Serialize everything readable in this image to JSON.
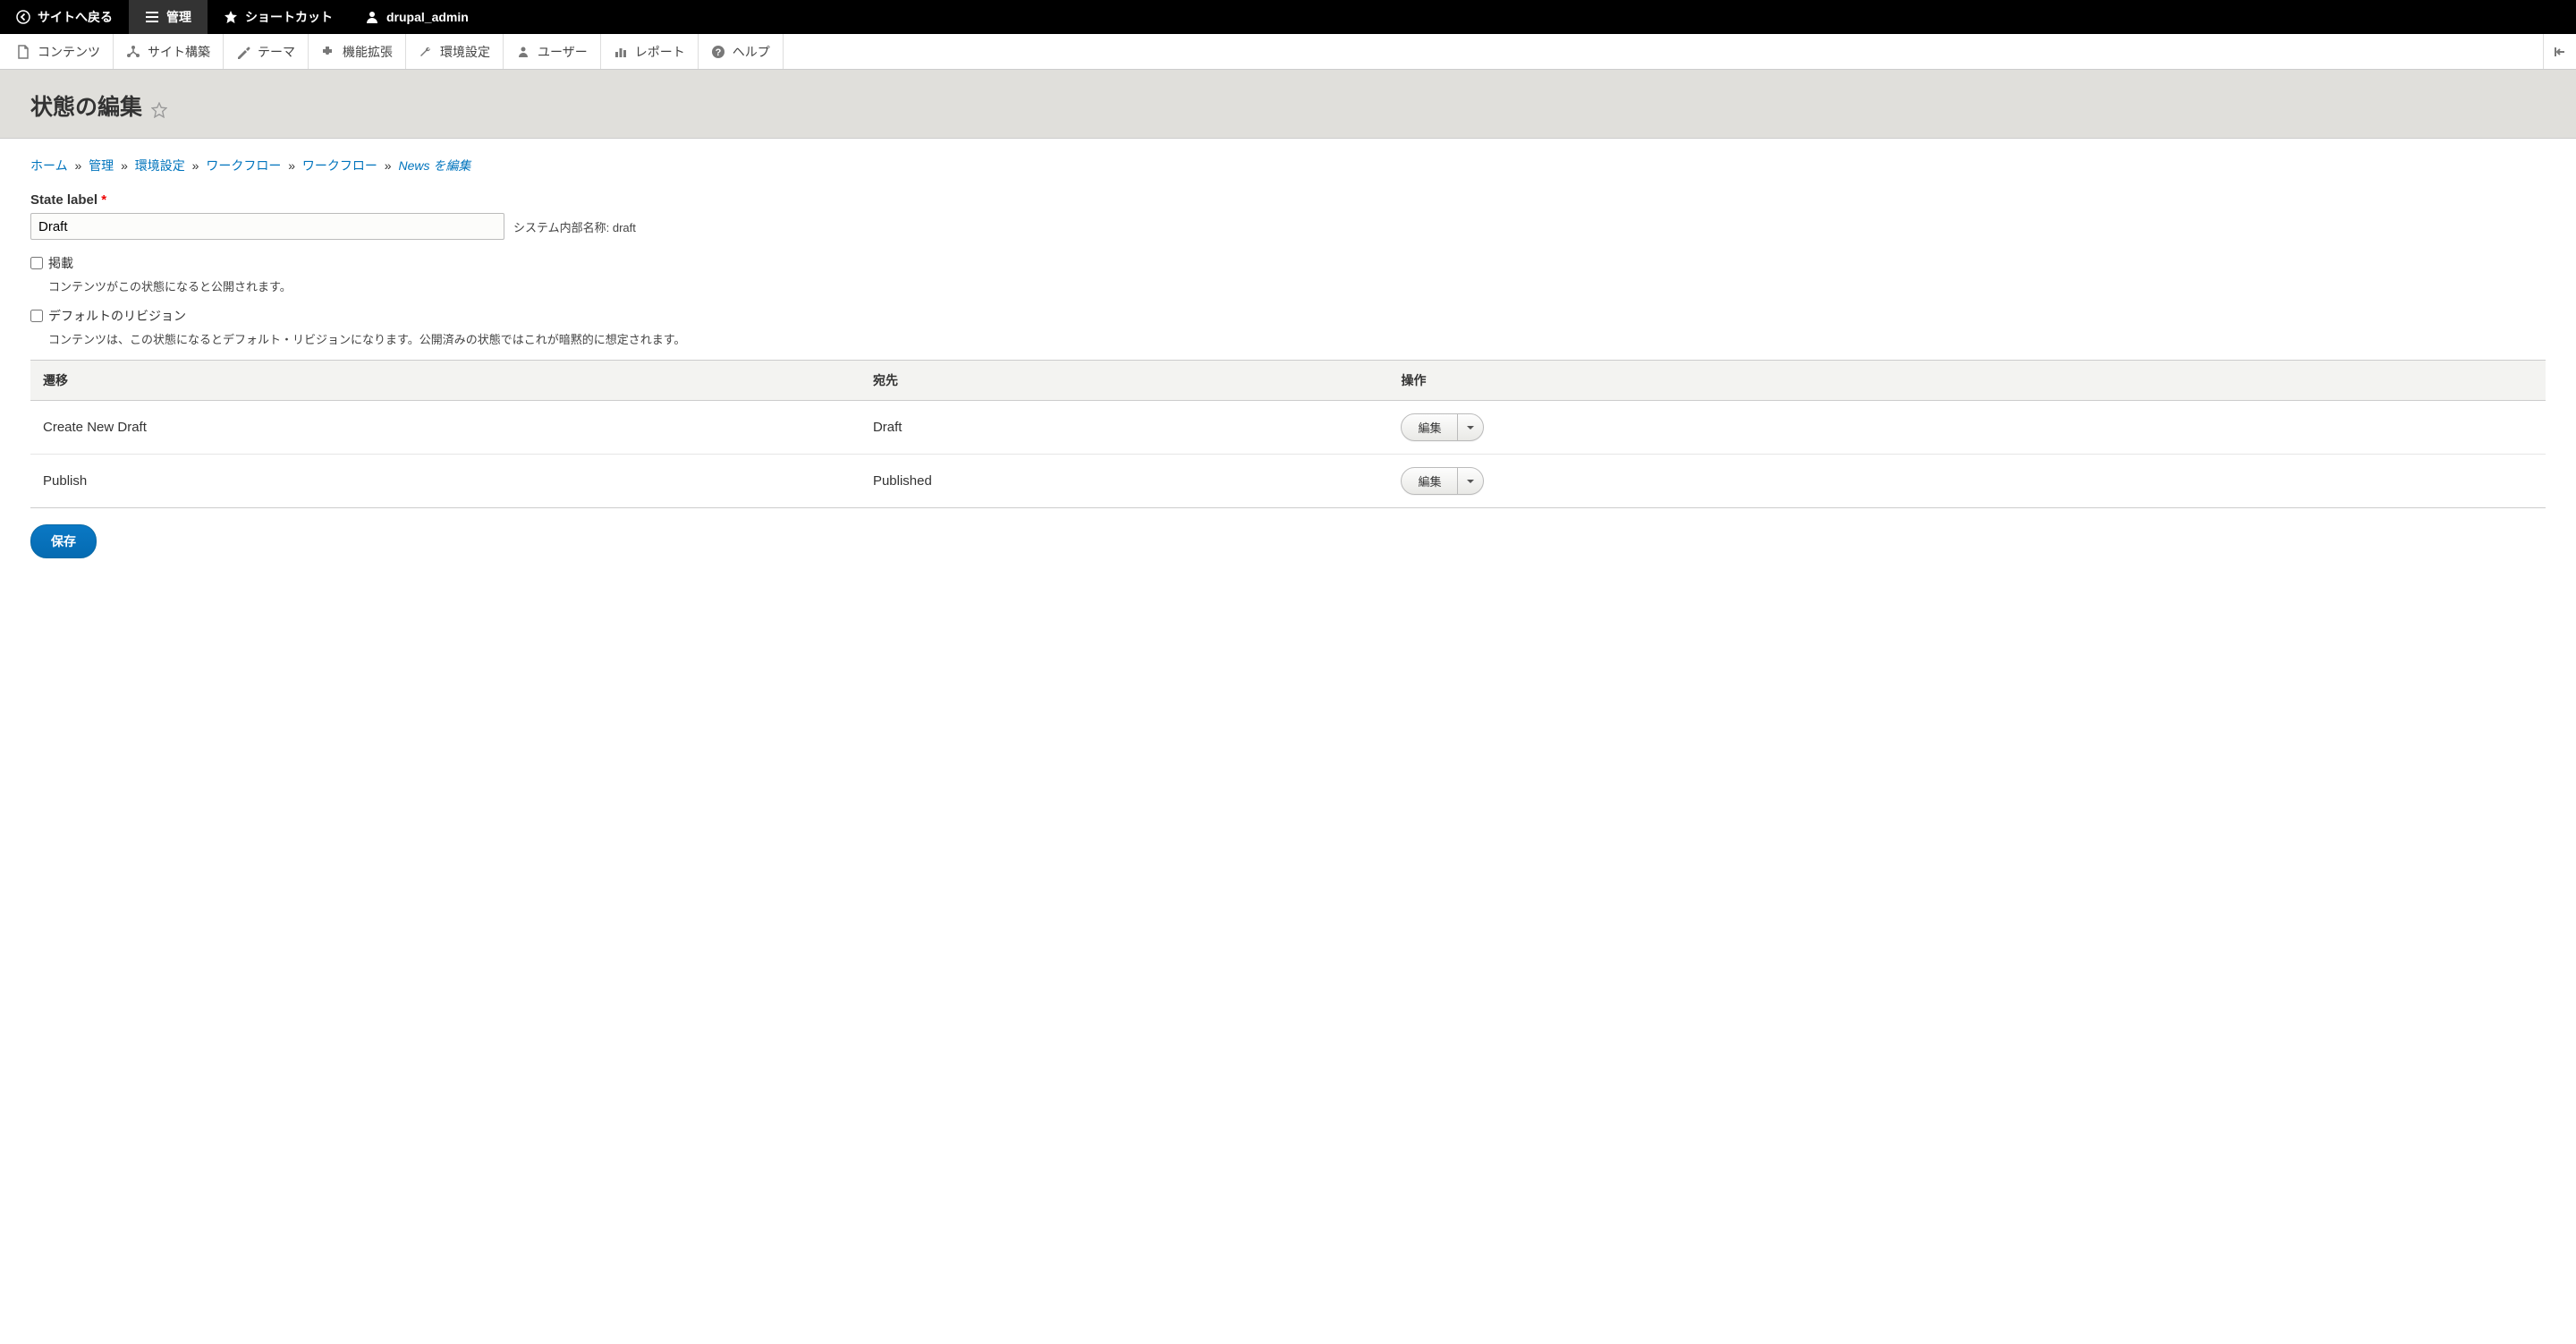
{
  "toolbar": {
    "back": "サイトへ戻る",
    "manage": "管理",
    "shortcuts": "ショートカット",
    "user": "drupal_admin"
  },
  "admin_menu": {
    "content": "コンテンツ",
    "structure": "サイト構築",
    "appearance": "テーマ",
    "extend": "機能拡張",
    "config": "環境設定",
    "people": "ユーザー",
    "reports": "レポート",
    "help": "ヘルプ"
  },
  "page": {
    "title": "状態の編集"
  },
  "breadcrumb": {
    "home": "ホーム",
    "manage": "管理",
    "config": "環境設定",
    "workflow1": "ワークフロー",
    "workflow2": "ワークフロー",
    "edit_news": "News を編集",
    "sep": "»"
  },
  "form": {
    "label_label": "State label",
    "label_value": "Draft",
    "machine_name_prefix": "システム内部名称:",
    "machine_name_value": "draft",
    "published_label": "掲載",
    "published_desc": "コンテンツがこの状態になると公開されます。",
    "default_rev_label": "デフォルトのリビジョン",
    "default_rev_desc": "コンテンツは、この状態になるとデフォルト・リビジョンになります。公開済みの状態ではこれが暗黙的に想定されます。"
  },
  "table": {
    "headers": {
      "transition": "遷移",
      "to": "宛先",
      "operations": "操作"
    },
    "rows": [
      {
        "transition": "Create New Draft",
        "to": "Draft",
        "op": "編集"
      },
      {
        "transition": "Publish",
        "to": "Published",
        "op": "編集"
      }
    ]
  },
  "actions": {
    "save": "保存"
  }
}
